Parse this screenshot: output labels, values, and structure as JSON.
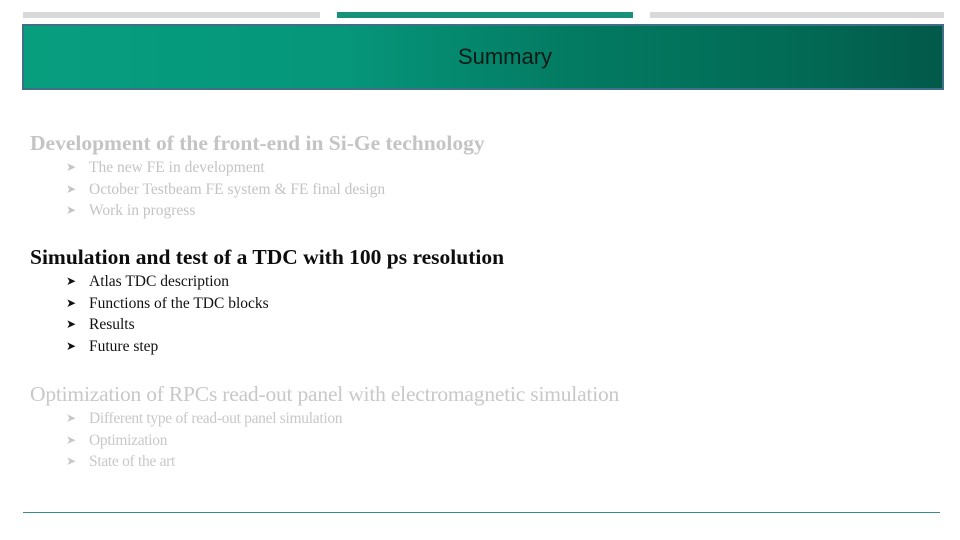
{
  "header": {
    "title": "Summary",
    "colors": {
      "gradient_start": "#079e7e",
      "gradient_end": "#02594a",
      "border": "#3f7088",
      "active_progress": "#17917a",
      "inactive_progress": "#d9d9d9"
    }
  },
  "progress_bar": {
    "segments": 3,
    "active_index": 1
  },
  "sections": [
    {
      "heading": "Development of the front-end in Si-Ge technology",
      "state": "dimmed",
      "items": [
        "The new FE in development",
        "October Testbeam FE system & FE final design",
        "Work in progress"
      ]
    },
    {
      "heading": "Simulation and test of a TDC with 100 ps resolution",
      "state": "active",
      "items": [
        "Atlas TDC description",
        "Functions of the TDC blocks",
        "Results",
        "Future step"
      ]
    },
    {
      "heading": "Optimization of RPCs read-out panel with electromagnetic simulation",
      "state": "dimmed",
      "items": [
        "Different type of read-out panel simulation",
        "Optimization",
        "State of the art"
      ]
    }
  ],
  "bullet_icon": "arrowhead-bullet"
}
